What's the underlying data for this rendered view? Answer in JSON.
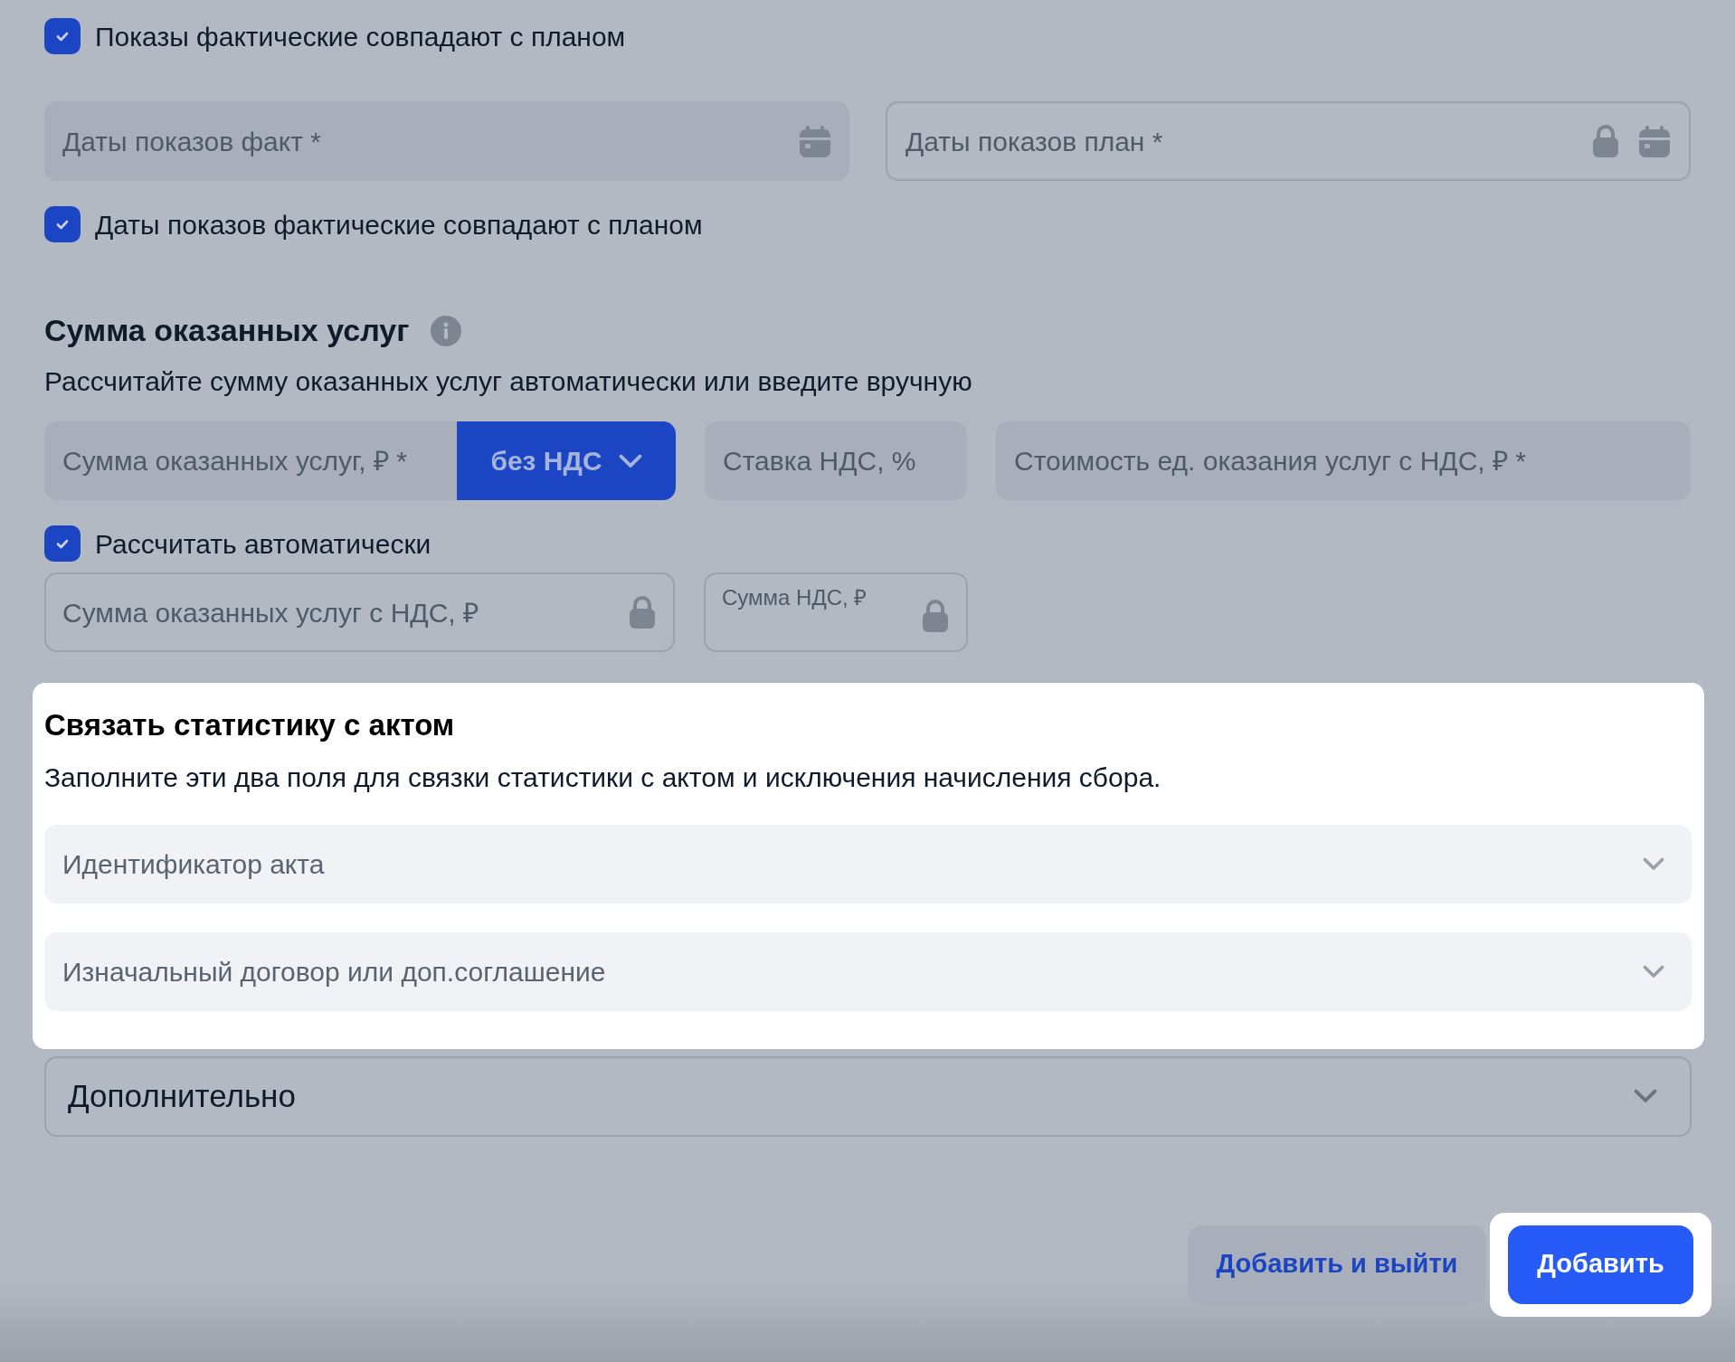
{
  "checkbox_shows": {
    "label": "Показы фактические совпадают с планом",
    "checked": true
  },
  "date_fields": [
    {
      "placeholder": "Даты показов факт *",
      "locked": false,
      "kind": "filled"
    },
    {
      "placeholder": "Даты показов план *",
      "locked": true,
      "kind": "outlined"
    }
  ],
  "checkbox_dates": {
    "label": "Даты показов фактические совпадают с планом",
    "checked": true
  },
  "services_sum": {
    "title": "Сумма оказанных услуг",
    "subtitle": "Рассчитайте сумму оказанных услуг автоматически или введите вручную",
    "sum_field": {
      "placeholder": "Сумма оказанных услуг, ₽ *"
    },
    "vat_dropdown": {
      "value": "без НДС"
    },
    "vat_rate_field": {
      "placeholder": "Ставка НДС, %"
    },
    "unit_cost_field": {
      "placeholder": "Стоимость ед. оказания услуг с НДС, ₽ *"
    },
    "auto_checkbox": {
      "label": "Рассчитать автоматически",
      "checked": true
    },
    "locked_fields": [
      {
        "label": "Сумма оказанных услуг с НДС, ₽",
        "kind": "placeholder"
      },
      {
        "label": "Сумма НДС, ₽",
        "kind": "floating"
      }
    ]
  },
  "link_card": {
    "title": "Связать статистику с актом",
    "subtitle": "Заполните эти два поля для связки статистики с актом и исключения начисления сбора.",
    "selects": [
      {
        "placeholder": "Идентификатор акта"
      },
      {
        "placeholder": "Изначальный договор или доп.соглашение"
      }
    ]
  },
  "additional": {
    "label": "Дополнительно",
    "expanded": false
  },
  "buttons": [
    {
      "label": "Добавить и выйти",
      "kind": "secondary",
      "highlighted": false
    },
    {
      "label": "Добавить",
      "kind": "primary",
      "highlighted": true
    }
  ]
}
